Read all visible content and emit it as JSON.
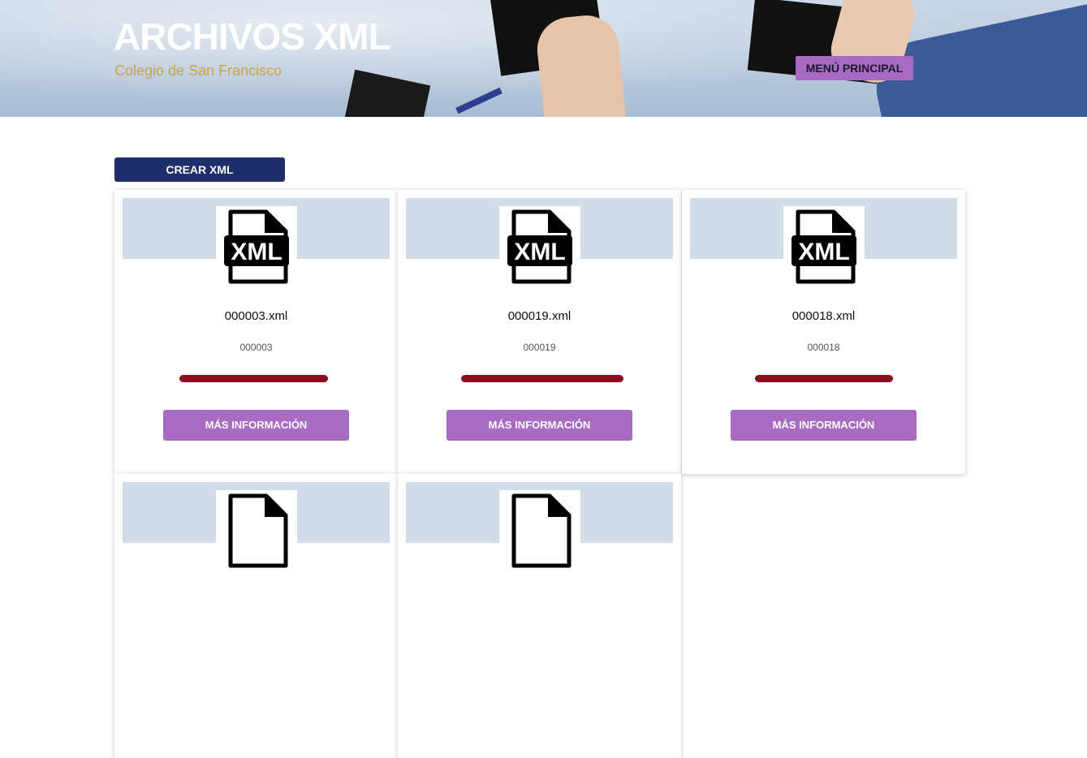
{
  "header": {
    "title": "ARCHIVOS XML",
    "subtitle": "Colegio de San Francisco",
    "menu_label": "MENÚ PRINCIPAL"
  },
  "toolbar": {
    "create_label": "CREAR XML"
  },
  "cards": [
    {
      "filename": "000003.xml",
      "id": "000003",
      "icon": "xml-file-icon",
      "button": "MÁS INFORMACIÓN"
    },
    {
      "filename": "000019.xml",
      "id": "000019",
      "icon": "xml-file-icon",
      "button": "MÁS INFORMACIÓN"
    },
    {
      "filename": "000018.xml",
      "id": "000018",
      "icon": "xml-file-icon",
      "button": "MÁS INFORMACIÓN"
    },
    {
      "icon": "xml-file-icon"
    },
    {
      "icon": "xml-file-icon"
    }
  ],
  "icon_label": "XML",
  "colors": {
    "accent": "#a96bc1",
    "primary": "#1f2f6b",
    "subtitle": "#c9a642",
    "card_band": "#d1dce9",
    "redaction": "#8a0d22"
  }
}
